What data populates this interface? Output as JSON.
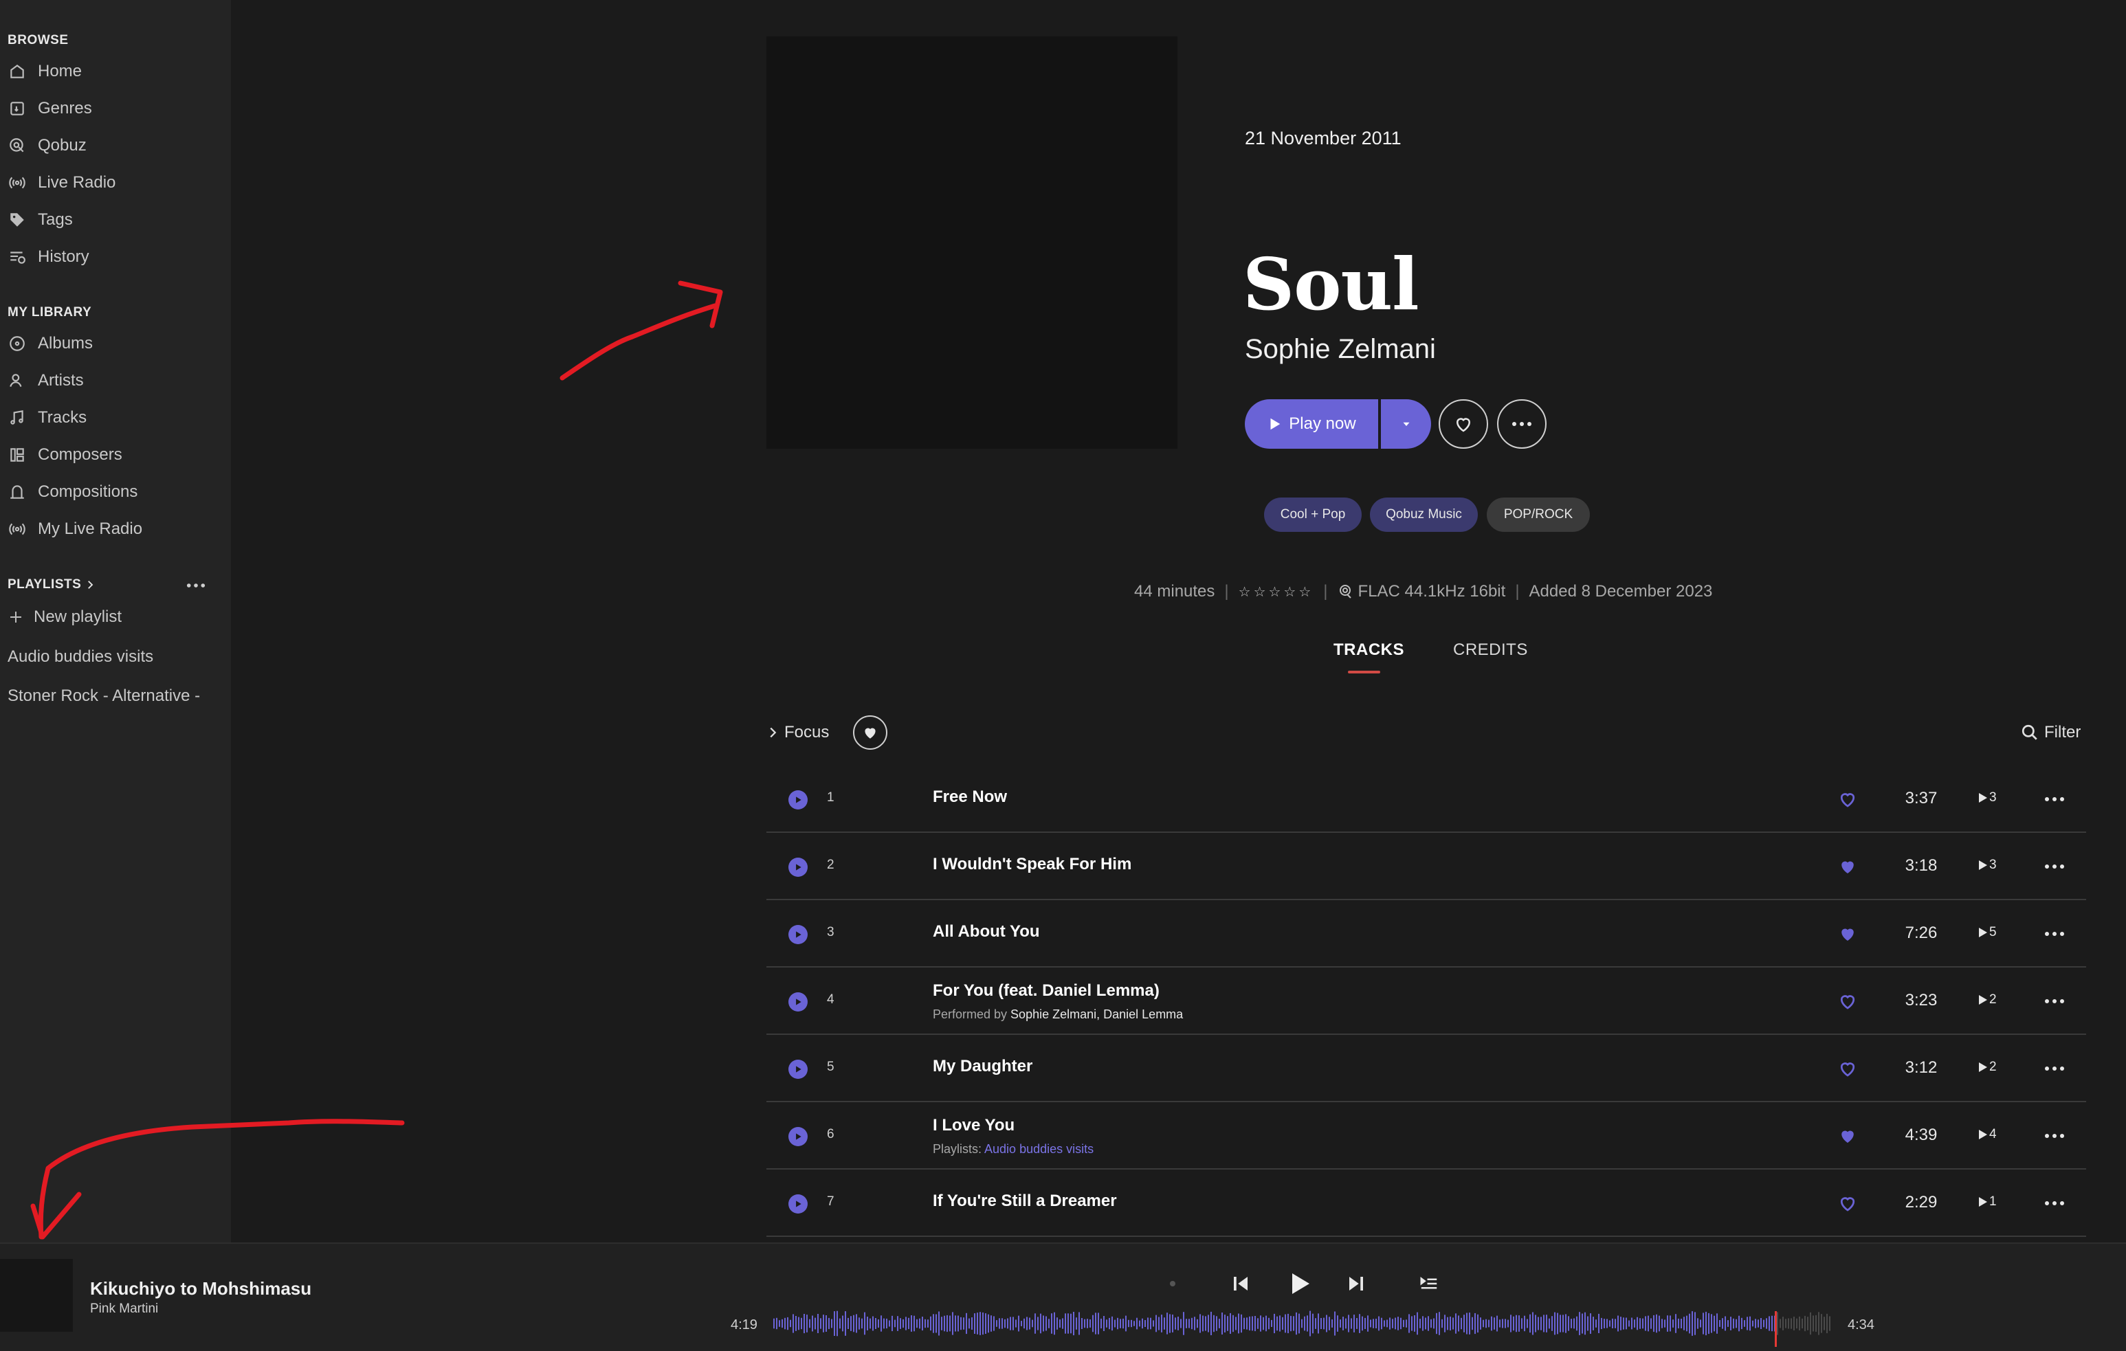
{
  "sidebar": {
    "browse_header": "BROWSE",
    "browse_items": [
      {
        "label": "Home",
        "icon": "home-icon"
      },
      {
        "label": "Genres",
        "icon": "genres-icon"
      },
      {
        "label": "Qobuz",
        "icon": "qobuz-icon"
      },
      {
        "label": "Live Radio",
        "icon": "radio-icon"
      },
      {
        "label": "Tags",
        "icon": "tag-icon"
      },
      {
        "label": "History",
        "icon": "history-icon"
      }
    ],
    "library_header": "MY LIBRARY",
    "library_items": [
      {
        "label": "Albums",
        "icon": "album-icon"
      },
      {
        "label": "Artists",
        "icon": "artist-icon"
      },
      {
        "label": "Tracks",
        "icon": "music-note-icon"
      },
      {
        "label": "Composers",
        "icon": "composer-icon"
      },
      {
        "label": "Compositions",
        "icon": "composition-icon"
      },
      {
        "label": "My Live Radio",
        "icon": "radio-icon"
      }
    ],
    "playlists_header": "PLAYLISTS",
    "new_playlist": "New playlist",
    "playlists": [
      "Audio buddies visits",
      "Stoner Rock - Alternative -"
    ]
  },
  "album": {
    "release_date": "21 November 2011",
    "title": "Soul",
    "artist": "Sophie Zelmani",
    "play_label": "Play now",
    "tags": [
      "Cool + Pop",
      "Qobuz Music",
      "POP/ROCK"
    ],
    "duration": "44 minutes",
    "rating_stars": "☆☆☆☆☆",
    "rating": 0,
    "format": "FLAC 44.1kHz 16bit",
    "added": "Added 8 December 2023"
  },
  "tabs": {
    "tracks": "TRACKS",
    "credits": "CREDITS",
    "active": "TRACKS"
  },
  "toolbar": {
    "focus": "Focus",
    "filter": "Filter"
  },
  "tracks": [
    {
      "num": "1",
      "title": "Free Now",
      "duration": "3:37",
      "plays": "3",
      "loved": false
    },
    {
      "num": "2",
      "title": "I Wouldn't Speak For Him",
      "duration": "3:18",
      "plays": "3",
      "loved": true
    },
    {
      "num": "3",
      "title": "All About You",
      "duration": "7:26",
      "plays": "5",
      "loved": true
    },
    {
      "num": "4",
      "title": "For You (feat. Daniel Lemma)",
      "sub_prefix": "Performed by ",
      "sub_a": "Sophie Zelmani",
      "sub_sep": ", ",
      "sub_b": "Daniel Lemma",
      "duration": "3:23",
      "plays": "2",
      "loved": false
    },
    {
      "num": "5",
      "title": "My Daughter",
      "duration": "3:12",
      "plays": "2",
      "loved": false
    },
    {
      "num": "6",
      "title": "I Love You",
      "sub_prefix": "Playlists: ",
      "sub_link": "Audio buddies visits",
      "duration": "4:39",
      "plays": "4",
      "loved": true
    },
    {
      "num": "7",
      "title": "If You're Still a Dreamer",
      "duration": "2:29",
      "plays": "1",
      "loved": false
    }
  ],
  "player": {
    "title": "Kikuchiyo to Mohshimasu",
    "artist": "Pink Martini",
    "elapsed": "4:19",
    "total": "4:34",
    "progress": 0.946
  },
  "colors": {
    "accent": "#6a63d6",
    "tab_underline": "#d24b45",
    "annotation": "#e31b23",
    "playhead": "#e53935"
  }
}
